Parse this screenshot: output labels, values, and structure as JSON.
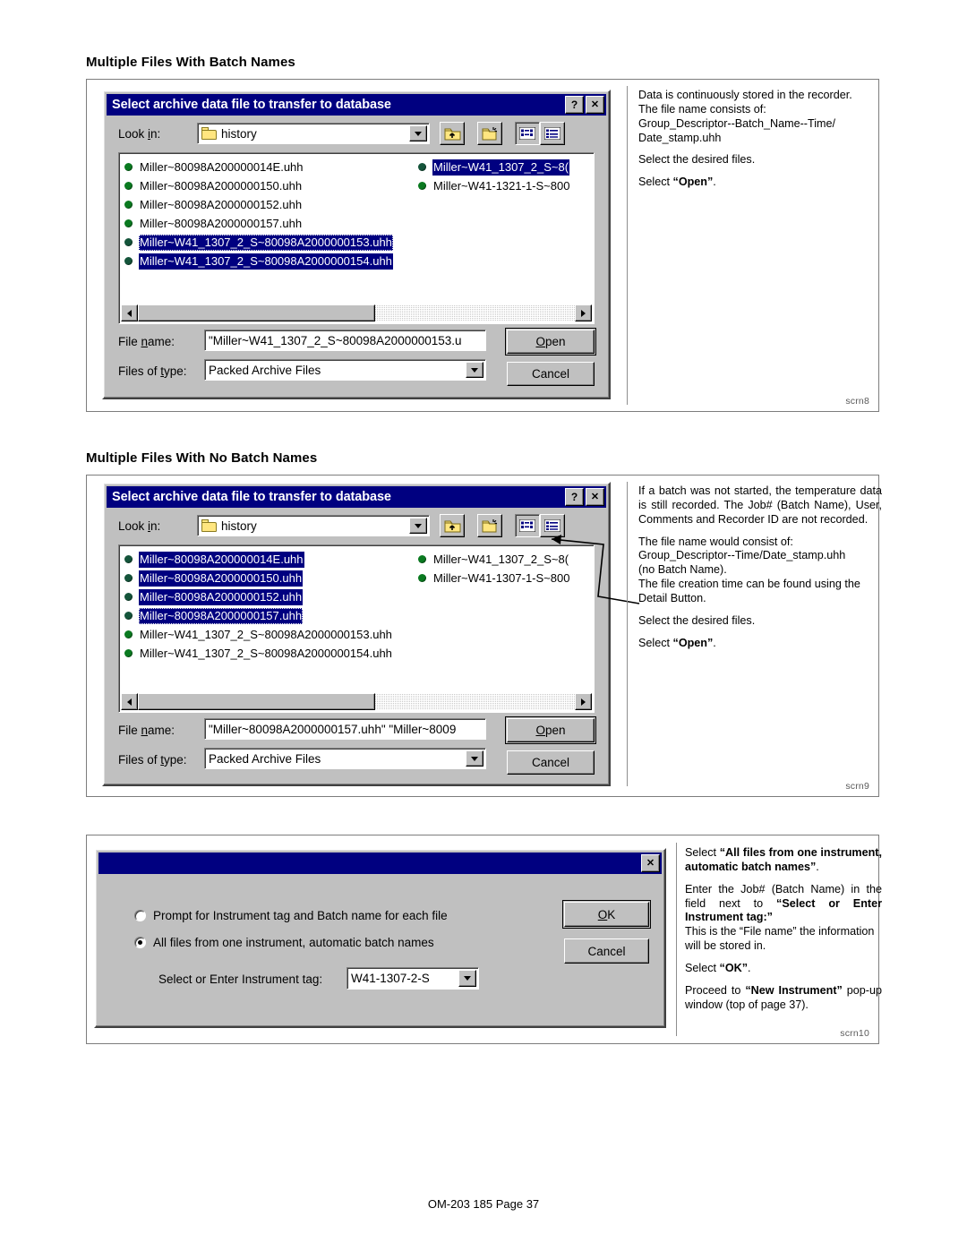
{
  "sections": [
    {
      "heading": "Multiple Files With Batch Names",
      "scrn": "scrn8"
    },
    {
      "heading": "Multiple Files With No Batch Names",
      "scrn": "scrn9"
    },
    {
      "heading": "",
      "scrn": "scrn10"
    }
  ],
  "dialog1": {
    "title": "Select archive data file to transfer to database",
    "help_button": "?",
    "close_button": "✕",
    "lookin_label_pre": "Look ",
    "lookin_label_key": "i",
    "lookin_label_post": "n:",
    "lookin_value": "history",
    "toolbar": {
      "up_folder": "up-one-level",
      "new_folder": "create-new-folder",
      "list_view": "list-view",
      "detail_view": "details-view"
    },
    "files_left": [
      {
        "name": "Miller~80098A200000014E.uhh",
        "selected": false
      },
      {
        "name": "Miller~80098A2000000150.uhh",
        "selected": false
      },
      {
        "name": "Miller~80098A2000000152.uhh",
        "selected": false
      },
      {
        "name": "Miller~80098A2000000157.uhh",
        "selected": false
      },
      {
        "name": "Miller~W41_1307_2_S~80098A2000000153.uhh",
        "selected": true,
        "focus": true
      },
      {
        "name": "Miller~W41_1307_2_S~80098A2000000154.uhh",
        "selected": true,
        "focus": false
      }
    ],
    "files_right": [
      {
        "name": "Miller~W41_1307_2_S~8(",
        "selected": true,
        "focus": false
      },
      {
        "name": "Miller~W41-1321-1-S~800",
        "selected": false,
        "focus": false
      }
    ],
    "filename_label_pre": "File ",
    "filename_label_key": "n",
    "filename_label_post": "ame:",
    "filename_value": "\"Miller~W41_1307_2_S~80098A2000000153.u",
    "filetype_label_pre": "Files of ",
    "filetype_label_key": "t",
    "filetype_label_post": "ype:",
    "filetype_value": "Packed Archive Files",
    "open_label_key": "O",
    "open_label_post": "pen",
    "cancel_label": "Cancel"
  },
  "dialog2": {
    "title": "Select archive data file to transfer to database",
    "help_button": "?",
    "close_button": "✕",
    "lookin_label_pre": "Look ",
    "lookin_label_key": "i",
    "lookin_label_post": "n:",
    "lookin_value": "history",
    "files_left": [
      {
        "name": "Miller~80098A200000014E.uhh",
        "selected": true,
        "focus": false
      },
      {
        "name": "Miller~80098A2000000150.uhh",
        "selected": true,
        "focus": false
      },
      {
        "name": "Miller~80098A2000000152.uhh",
        "selected": true,
        "focus": false
      },
      {
        "name": "Miller~80098A2000000157.uhh",
        "selected": true,
        "focus": true
      },
      {
        "name": "Miller~W41_1307_2_S~80098A2000000153.uhh",
        "selected": false,
        "focus": false
      },
      {
        "name": "Miller~W41_1307_2_S~80098A2000000154.uhh",
        "selected": false,
        "focus": false
      }
    ],
    "files_right": [
      {
        "name": "Miller~W41_1307_2_S~8(",
        "selected": false,
        "focus": false
      },
      {
        "name": "Miller~W41-1307-1-S~800",
        "selected": false,
        "focus": false
      }
    ],
    "filename_label_pre": "File ",
    "filename_label_key": "n",
    "filename_label_post": "ame:",
    "filename_value": "\"Miller~80098A2000000157.uhh\" \"Miller~8009",
    "filetype_label_pre": "Files of ",
    "filetype_label_key": "t",
    "filetype_label_post": "ype:",
    "filetype_value": "Packed Archive Files",
    "open_label_key": "O",
    "open_label_post": "pen",
    "cancel_label": "Cancel"
  },
  "dialog3": {
    "title": "",
    "close_button": "✕",
    "option1_label_pre": "Prompt for Instrument ta",
    "option1_label_key": "g",
    "option1_label_post": " and Batch name for each file",
    "option1_selected": false,
    "option2_label": "All files from one instrument, automatic batch names",
    "option2_selected": true,
    "tag_label_pre": "Select or Enter Instrument ta",
    "tag_label_key": "g",
    "tag_label_post": ":",
    "tag_value": "W41-1307-2-S",
    "ok_label_key": "O",
    "ok_label_post": "K",
    "cancel_label": "Cancel"
  },
  "notes": {
    "note1": {
      "p1_line1": "Data is continuously stored in the recorder.",
      "p1_line2": "The file name consists of:",
      "p1_line3": "Group_Descriptor--Batch_Name--Time/",
      "p1_line4": "Date_stamp.uhh",
      "p2": "Select the desired files.",
      "p3_pre": "Select ",
      "p3_bold": "“Open”",
      "p3_post": "."
    },
    "note2": {
      "p1": "If a batch was not started, the temperature data is still recorded. The Job# (Batch Name), User, Comments and Recorder ID are not recorded.",
      "p2_a": "The file name would consist of:",
      "p2_b": "Group_Descriptor--Time/Date_stamp.uhh",
      "p2_c": "(no Batch Name).",
      "p3": "The file creation time can be found using the Detail Button.",
      "p4": "Select the desired files.",
      "p5_pre": "Select ",
      "p5_bold": "“Open”",
      "p5_post": "."
    },
    "note3": {
      "p1_pre": "Select ",
      "p1_bold": "“All files from one instrument, automatic batch names”",
      "p1_post": ".",
      "p2_pre": "Enter the Job# (Batch Name) in the field next to ",
      "p2_bold": "“Select or Enter Instrument tag:”",
      "p2_post": "",
      "p3": "This is the “File name” the information will be stored in.",
      "p4_pre": "Select ",
      "p4_bold": "“OK”",
      "p4_post": ".",
      "p5_pre": "Proceed to ",
      "p5_bold": "“New Instrument”",
      "p5_post": " pop-up window (top of page 37)."
    }
  },
  "footer": "OM-203 185 Page 37",
  "colors": {
    "titlebar": "#000080",
    "selection": "#000080",
    "dialog_face": "#c0c0c0",
    "bullet_green": "#0a7a20",
    "bullet_dark": "#14543a"
  }
}
